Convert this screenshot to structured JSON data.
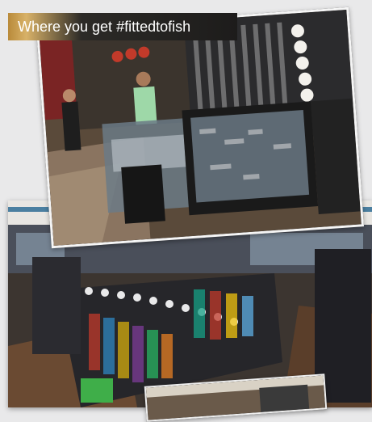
{
  "banner": {
    "text": "Where you get #fittedtofish"
  },
  "photos": [
    {
      "subject": "store-counter-photo"
    },
    {
      "subject": "store-aisles-photo"
    },
    {
      "subject": "store-interior-photo-partial"
    }
  ],
  "colors": {
    "banner_gold": "#d8b268",
    "banner_dark": "#1d1c1b",
    "page_bg": "#e9e9ea"
  }
}
